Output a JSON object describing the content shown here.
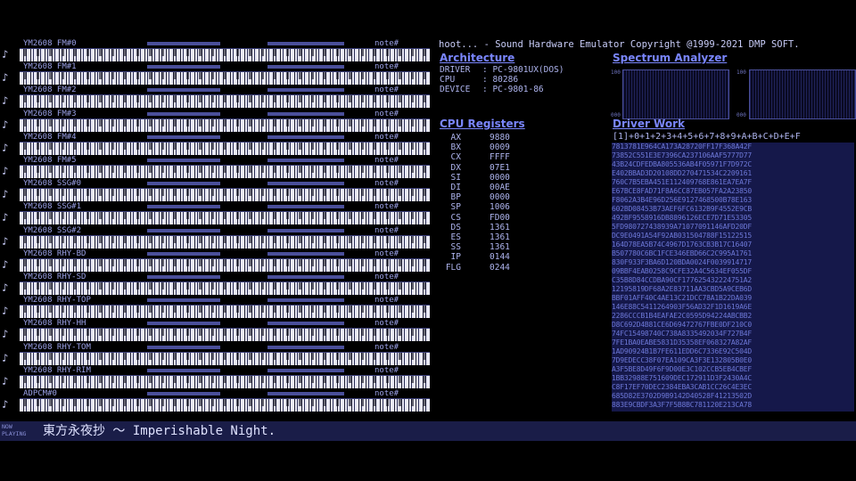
{
  "app": {
    "title": "hoot... - Sound Hardware Emulator Copyright @1999-2021 DMP SOFT."
  },
  "channels": [
    {
      "name": "YM2608 FM#0",
      "note": "note#"
    },
    {
      "name": "YM2608 FM#1",
      "note": "note#"
    },
    {
      "name": "YM2608 FM#2",
      "note": "note#"
    },
    {
      "name": "YM2608 FM#3",
      "note": "note#"
    },
    {
      "name": "YM2608 FM#4",
      "note": "note#"
    },
    {
      "name": "YM2608 FM#5",
      "note": "note#"
    },
    {
      "name": "YM2608 SSG#0",
      "note": "note#"
    },
    {
      "name": "YM2608 SSG#1",
      "note": "note#"
    },
    {
      "name": "YM2608 SSG#2",
      "note": "note#"
    },
    {
      "name": "YM2608 RHY-BD",
      "note": "note#"
    },
    {
      "name": "YM2608 RHY-SD",
      "note": "note#"
    },
    {
      "name": "YM2608 RHY-TOP",
      "note": "note#"
    },
    {
      "name": "YM2608 RHY-HH",
      "note": "note#"
    },
    {
      "name": "YM2608 RHY-TOM",
      "note": "note#"
    },
    {
      "name": "YM2608 RHY-RIM",
      "note": "note#"
    },
    {
      "name": "ADPCM#0",
      "note": "note#"
    }
  ],
  "architecture": {
    "heading": "Architecture",
    "rows": [
      {
        "k": "DRIVER",
        "v": "PC-9801UX(DOS)"
      },
      {
        "k": "CPU",
        "v": "80286"
      },
      {
        "k": "DEVICE",
        "v": "PC-9801-86"
      }
    ]
  },
  "registers": {
    "heading": "CPU Registers",
    "rows": [
      {
        "k": "AX",
        "v": "9880"
      },
      {
        "k": "BX",
        "v": "0009"
      },
      {
        "k": "CX",
        "v": "FFFF"
      },
      {
        "k": "DX",
        "v": "07E1"
      },
      {
        "k": "SI",
        "v": "0000"
      },
      {
        "k": "DI",
        "v": "00AE"
      },
      {
        "k": "BP",
        "v": "0000"
      },
      {
        "k": "SP",
        "v": "1006"
      },
      {
        "k": "CS",
        "v": "FD00"
      },
      {
        "k": "DS",
        "v": "1361"
      },
      {
        "k": "ES",
        "v": "1361"
      },
      {
        "k": "SS",
        "v": "1361"
      },
      {
        "k": "IP",
        "v": "0144"
      },
      {
        "k": "FLG",
        "v": "0244"
      }
    ]
  },
  "spectrum": {
    "heading": "Spectrum Analyzer",
    "scale_top": "100",
    "scale_bottom": "000"
  },
  "driver_work": {
    "heading": "Driver Work",
    "columns": "[1]+0+1+2+3+4+5+6+7+8+9+A+B+C+D+E+F"
  },
  "status": {
    "label_top": "NOW",
    "label_bottom": "PLAYING",
    "song": "東方永夜抄 〜 Imperishable Night."
  },
  "colors": {
    "background": "#000000",
    "accent": "#7a86ff",
    "panel": "#15184a",
    "status_bar": "#1a1d48"
  }
}
